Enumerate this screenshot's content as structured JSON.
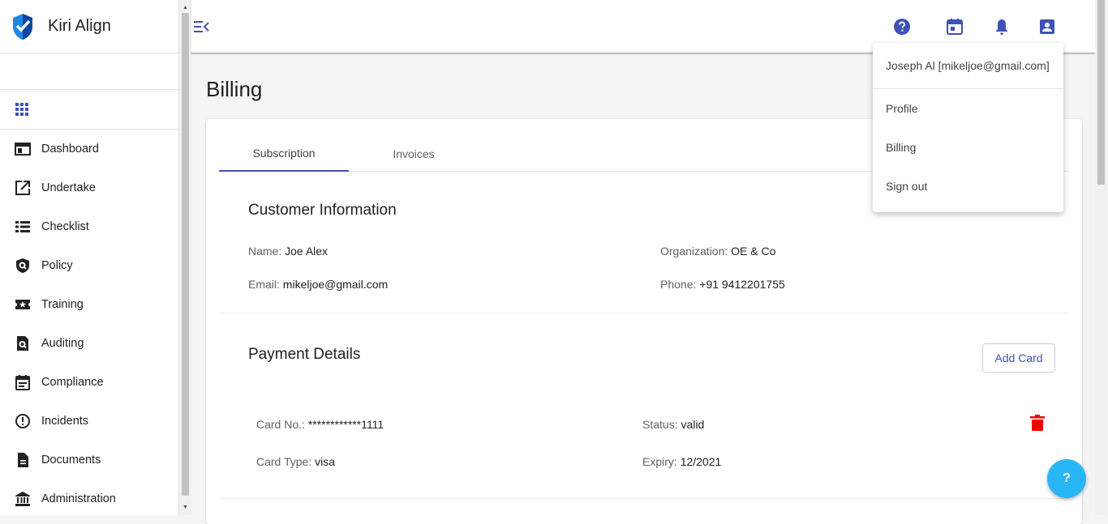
{
  "app": {
    "name": "Kiri Align"
  },
  "sidebar": {
    "items": [
      {
        "label": "Dashboard"
      },
      {
        "label": "Undertake"
      },
      {
        "label": "Checklist"
      },
      {
        "label": "Policy"
      },
      {
        "label": "Training"
      },
      {
        "label": "Auditing"
      },
      {
        "label": "Compliance"
      },
      {
        "label": "Incidents"
      },
      {
        "label": "Documents"
      },
      {
        "label": "Administration"
      }
    ]
  },
  "header": {
    "icons": [
      "help-icon",
      "calendar-icon",
      "bell-icon",
      "account-icon"
    ]
  },
  "page": {
    "title": "Billing"
  },
  "tabs": [
    {
      "label": "Subscription",
      "active": true
    },
    {
      "label": "Invoices",
      "active": false
    }
  ],
  "customer": {
    "title": "Customer Information",
    "name_label": "Name:",
    "name_value": "Joe Alex",
    "org_label": "Organization:",
    "org_value": "OE & Co",
    "email_label": "Email:",
    "email_value": "mikeljoe@gmail.com",
    "phone_label": "Phone:",
    "phone_value": "+91 9412201755"
  },
  "payment": {
    "title": "Payment Details",
    "add_card_label": "Add Card",
    "card_no_label": "Card No.:",
    "card_no_value": "************1111",
    "status_label": "Status:",
    "status_value": "valid",
    "card_type_label": "Card Type:",
    "card_type_value": "visa",
    "expiry_label": "Expiry:",
    "expiry_value": "12/2021"
  },
  "user_menu": {
    "header": "Joseph Al [mikeljoe@gmail.com]",
    "items": [
      {
        "label": "Profile"
      },
      {
        "label": "Billing"
      },
      {
        "label": "Sign out"
      }
    ]
  },
  "help_fab": {
    "label": "?"
  },
  "colors": {
    "primary": "#3f51b5",
    "accent": "#29b6f6",
    "danger": "#f50000"
  }
}
